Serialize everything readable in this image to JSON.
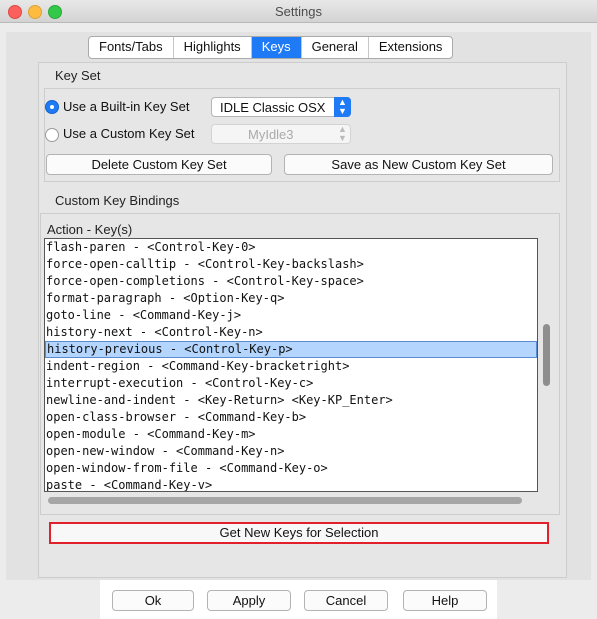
{
  "window": {
    "title": "Settings"
  },
  "tabs": [
    {
      "label": "Fonts/Tabs",
      "active": false
    },
    {
      "label": "Highlights",
      "active": false
    },
    {
      "label": "Keys",
      "active": true
    },
    {
      "label": "General",
      "active": false
    },
    {
      "label": "Extensions",
      "active": false
    }
  ],
  "keyset": {
    "group_label": "Key Set",
    "builtin_label": "Use a Built-in Key Set",
    "builtin_selected": true,
    "builtin_value": "IDLE Classic OSX",
    "custom_label": "Use a Custom Key Set",
    "custom_selected": false,
    "custom_value": "MyIdle3",
    "delete_button": "Delete Custom Key Set",
    "save_button": "Save as New Custom Key Set"
  },
  "bindings": {
    "group_label": "Custom Key Bindings",
    "list_header": "Action - Key(s)",
    "items": [
      "flash-paren - <Control-Key-0>",
      "force-open-calltip - <Control-Key-backslash>",
      "force-open-completions - <Control-Key-space>",
      "format-paragraph - <Option-Key-q>",
      "goto-line - <Command-Key-j>",
      "history-next - <Control-Key-n>",
      "history-previous - <Control-Key-p>",
      "indent-region - <Command-Key-bracketright>",
      "interrupt-execution - <Control-Key-c>",
      "newline-and-indent - <Key-Return> <Key-KP_Enter>",
      "open-class-browser - <Command-Key-b>",
      "open-module - <Command-Key-m>",
      "open-new-window - <Command-Key-n>",
      "open-window-from-file - <Command-Key-o>",
      "paste - <Command-Key-v>"
    ],
    "selected_index": 6,
    "get_new_keys_button": "Get New Keys for Selection"
  },
  "footer": {
    "ok": "Ok",
    "apply": "Apply",
    "cancel": "Cancel",
    "help": "Help"
  },
  "colors": {
    "accent": "#1f7af6",
    "selection": "#b4d5fe",
    "highlight_border": "#e0212b"
  }
}
